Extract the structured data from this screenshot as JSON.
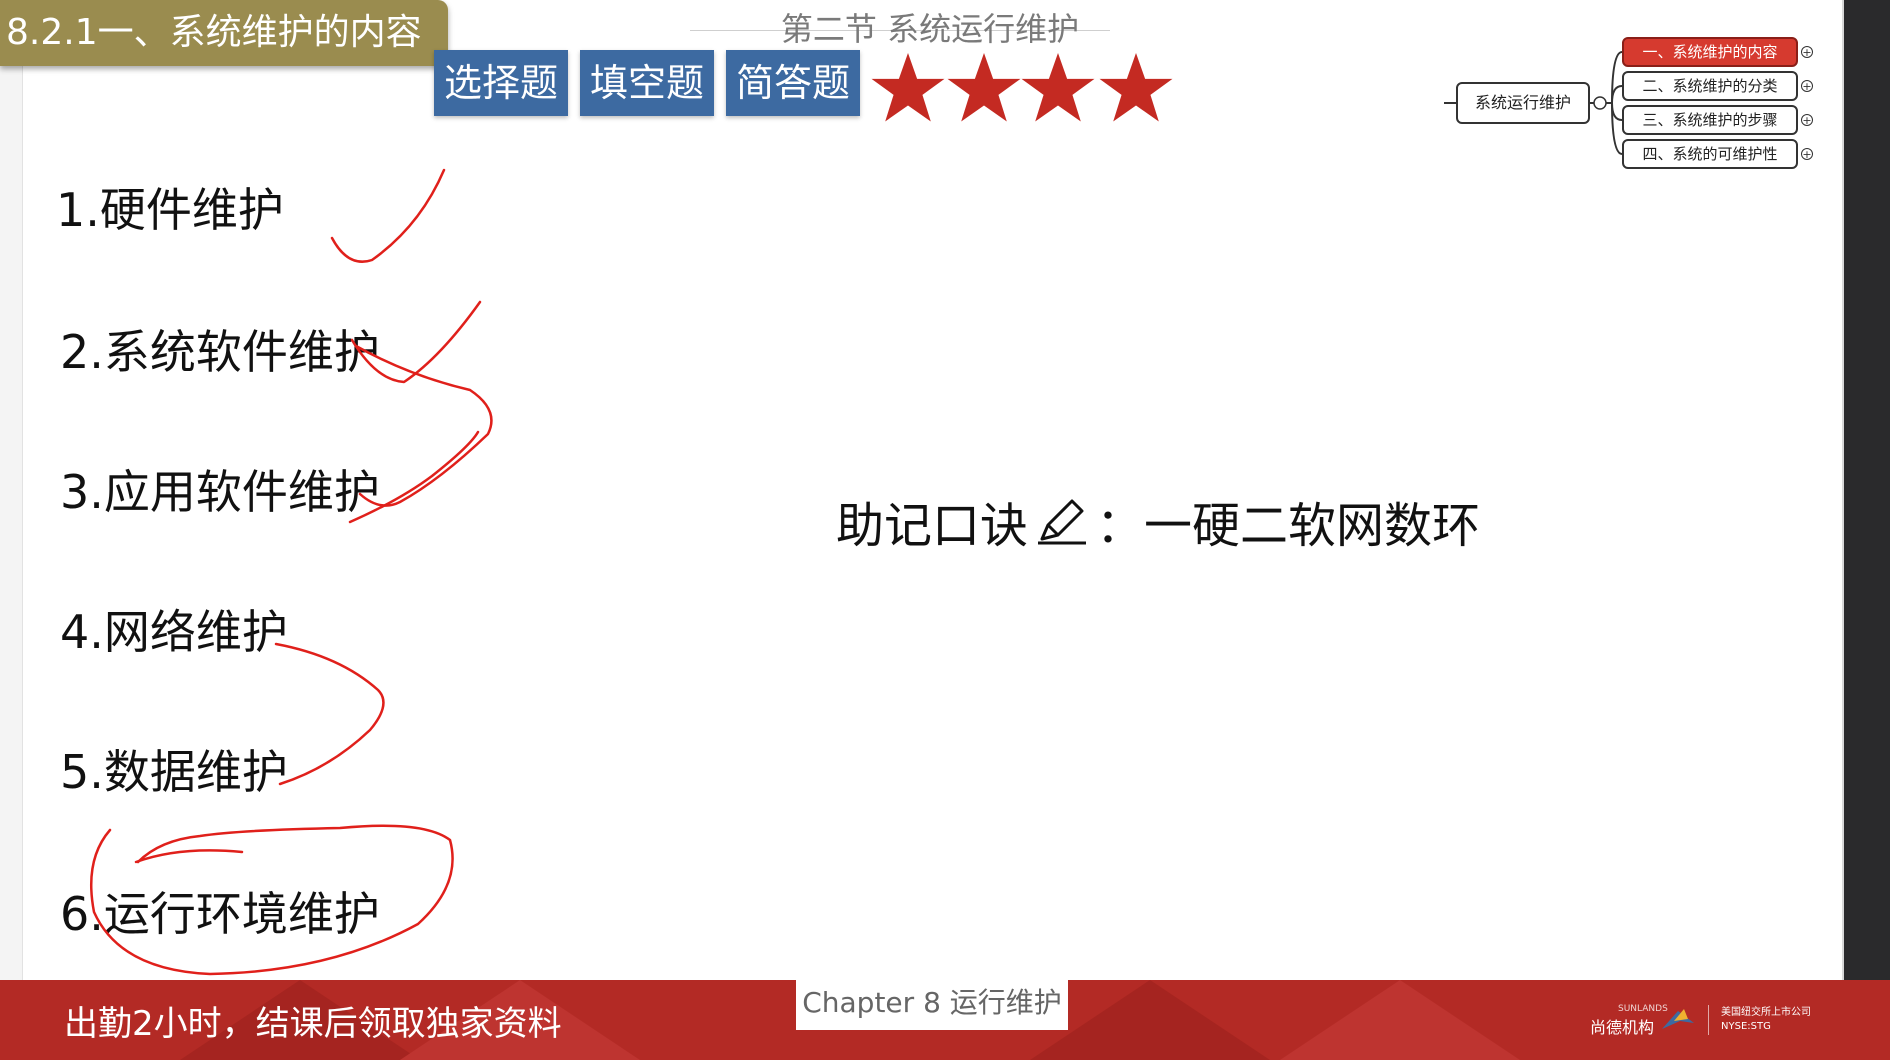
{
  "section_tag": "8.2.1一、系统维护的内容",
  "top_title": "第二节 系统运行维护",
  "question_types": [
    "选择题",
    "填空题",
    "简答题"
  ],
  "star_rating": 4,
  "star_color": "#c42a22",
  "maintenance_items": [
    "1.硬件维护",
    "2.系统软件维护",
    "3.应用软件维护",
    "4.网络维护",
    "5.数据维护",
    "6.运行环境维护"
  ],
  "mnemonic": {
    "label": "助记口诀",
    "icon": "pen-icon",
    "colon": "：",
    "text": "一硬二软网数环"
  },
  "mindmap": {
    "root": "系统运行维护",
    "children": [
      {
        "label": "一、系统维护的内容",
        "active": true
      },
      {
        "label": "二、系统维护的分类",
        "active": false
      },
      {
        "label": "三、系统维护的步骤",
        "active": false
      },
      {
        "label": "四、系统的可维护性",
        "active": false
      }
    ],
    "active_color": "#d63a2f"
  },
  "footer": {
    "text": "出勤2小时，结课后领取独家资料",
    "chapter": "Chapter 8 运行维护",
    "brand_name": "尚德机构",
    "brand_sub": "SUNLANDS",
    "brand_right_line1": "美国纽交所上市公司",
    "brand_right_line2": "NYSE:STG",
    "background": "#b32a25"
  },
  "annotation_color": "#e0201b"
}
